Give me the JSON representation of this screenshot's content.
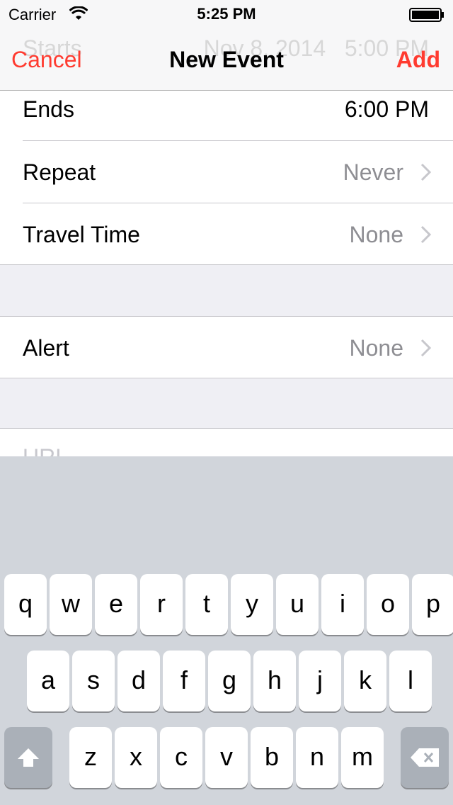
{
  "status_bar": {
    "carrier": "Carrier",
    "time": "5:25 PM",
    "icons": [
      "wifi-icon",
      "battery-icon"
    ]
  },
  "nav": {
    "cancel_label": "Cancel",
    "title": "New Event",
    "add_label": "Add",
    "behind_row": {
      "label": "Starts",
      "date": "Nov 8, 2014",
      "time": "5:00 PM"
    }
  },
  "rows": {
    "ends": {
      "label": "Ends",
      "value": "6:00 PM"
    },
    "repeat": {
      "label": "Repeat",
      "value": "Never"
    },
    "travel_time": {
      "label": "Travel Time",
      "value": "None"
    },
    "alert": {
      "label": "Alert",
      "value": "None"
    }
  },
  "url_field": {
    "placeholder": "URL"
  },
  "keyboard": {
    "row1": [
      "q",
      "w",
      "e",
      "r",
      "t",
      "y",
      "u",
      "i",
      "o",
      "p"
    ],
    "row2": [
      "a",
      "s",
      "d",
      "f",
      "g",
      "h",
      "j",
      "k",
      "l"
    ],
    "row3": [
      "z",
      "x",
      "c",
      "v",
      "b",
      "n",
      "m"
    ]
  },
  "colors": {
    "accent": "#ff3b30",
    "secondary_text": "#8e8e93",
    "keyboard_bg": "#d1d5db"
  }
}
